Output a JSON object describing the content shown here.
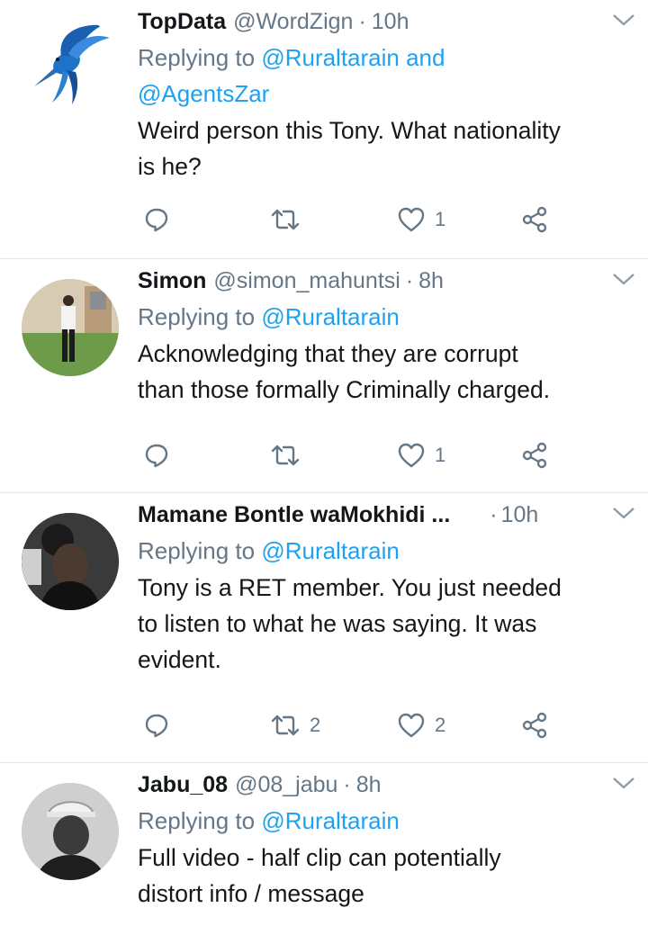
{
  "tweets": [
    {
      "name": "TopData",
      "handle": "@WordZign",
      "time": "10h",
      "replying_prefix": "Replying to",
      "replying_line1": "@Ruraltarain and",
      "replying_line2": "@AgentsZar",
      "text_lines": [
        "Weird person this Tony. What nationality",
        "is he?"
      ],
      "replies": "",
      "retweets": "",
      "likes": "1"
    },
    {
      "name": "Simon",
      "handle": "@simon_mahuntsi",
      "time": "8h",
      "replying_prefix": "Replying to",
      "replying_line1": "@Ruraltarain",
      "text_lines": [
        "Acknowledging that they are corrupt",
        "than those formally Criminally charged."
      ],
      "replies": "",
      "retweets": "",
      "likes": "1"
    },
    {
      "name": "Mamane Bontle waMokhidi ...",
      "handle": "",
      "time": "10h",
      "replying_prefix": "Replying to",
      "replying_line1": "@Ruraltarain",
      "text_lines": [
        "Tony is a RET member. You just needed",
        "to listen to what he was saying. It was",
        "evident."
      ],
      "replies": "",
      "retweets": "2",
      "likes": "2"
    },
    {
      "name": "Jabu_08",
      "handle": "@08_jabu",
      "time": "8h",
      "replying_prefix": "Replying to",
      "replying_line1": "@Ruraltarain",
      "text_lines": [
        "Full video - half clip can potentially",
        "distort info / message"
      ]
    }
  ],
  "separator": "·",
  "icons": {
    "more": "chevron-down-icon",
    "reply": "reply-icon",
    "retweet": "retweet-icon",
    "like": "heart-icon",
    "share": "share-icon"
  },
  "colors": {
    "text": "#14171a",
    "secondary": "#657786",
    "link": "#1da1f2",
    "divider": "#e1e8ed"
  }
}
